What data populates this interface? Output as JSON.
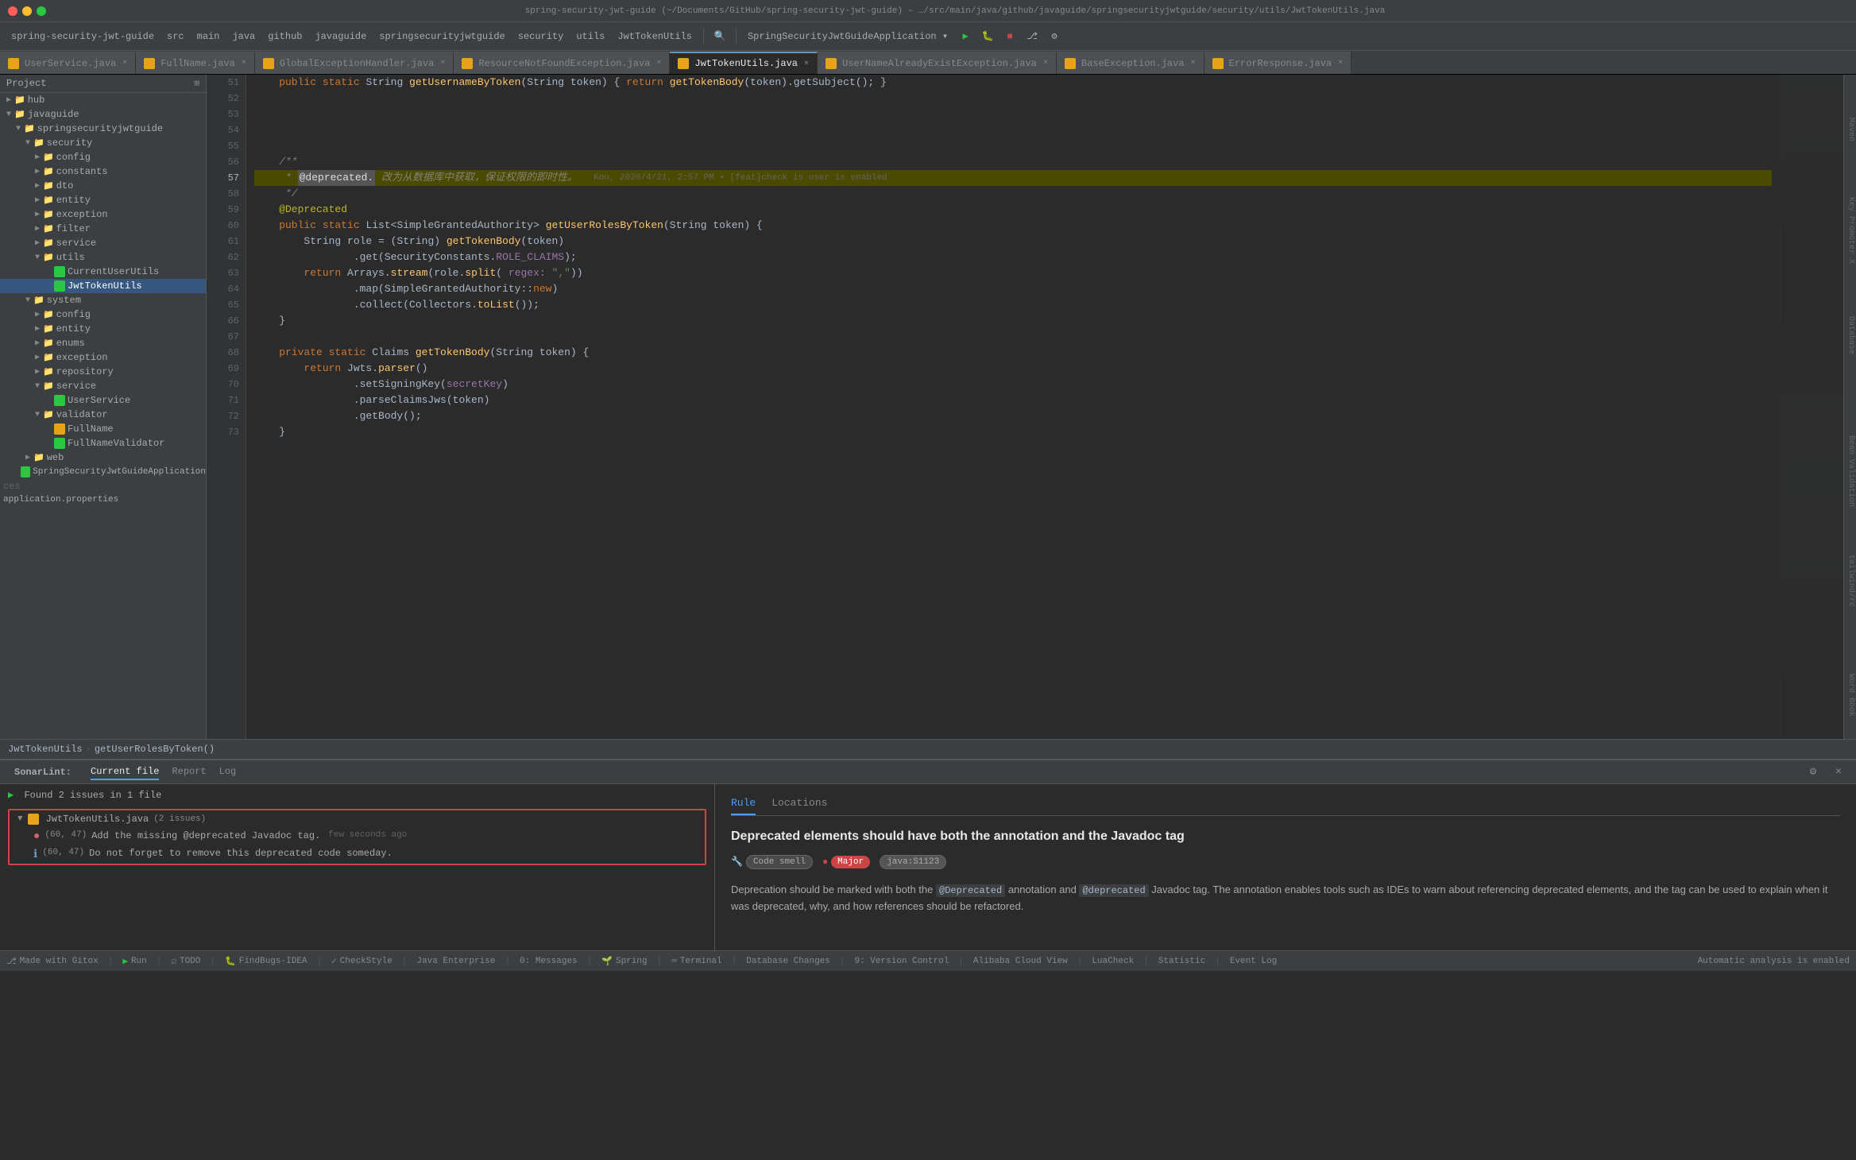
{
  "window": {
    "title": "spring-security-jwt-guide (~/Documents/GitHub/spring-security-jwt-guide) – …/src/main/java/github/javaguide/springsecurityjwtguide/security/utils/JwtTokenUtils.java",
    "traffic_lights": [
      "red",
      "yellow",
      "green"
    ]
  },
  "toolbar": {
    "project": "spring-security-jwt-guide",
    "src": "src",
    "main": "main",
    "java": "java",
    "github": "github",
    "javaguide": "javaguide",
    "springsecurityjwtguide": "springsecurityjwtguide",
    "security": "security",
    "utils": "utils",
    "file": "JwtTokenUtils",
    "run_config": "SpringSecurityJwtGuideApplication",
    "run_label": "SpringSecurityJwtGuideApplication"
  },
  "file_tabs": [
    {
      "label": "UserService.java",
      "icon": "java",
      "active": false
    },
    {
      "label": "FullName.java",
      "icon": "java",
      "active": false
    },
    {
      "label": "GlobalExceptionHandler.java",
      "icon": "java",
      "active": false
    },
    {
      "label": "ResourceNotFoundException.java",
      "icon": "java",
      "active": false
    },
    {
      "label": "JwtTokenUtils.java",
      "icon": "java",
      "active": true
    },
    {
      "label": "UserNameAlreadyExistException.java",
      "icon": "java",
      "active": false
    },
    {
      "label": "BaseException.java",
      "icon": "java",
      "active": false
    },
    {
      "label": "ErrorResponse.java",
      "icon": "java",
      "active": false
    }
  ],
  "project_tree": {
    "header": "Project",
    "items": [
      {
        "level": 0,
        "type": "folder",
        "name": "hub",
        "open": false
      },
      {
        "level": 0,
        "type": "folder",
        "name": "javaguide",
        "open": true
      },
      {
        "level": 1,
        "type": "folder",
        "name": "springsecurityjwtguide",
        "open": true
      },
      {
        "level": 2,
        "type": "folder",
        "name": "security",
        "open": true
      },
      {
        "level": 3,
        "type": "folder",
        "name": "config",
        "open": false
      },
      {
        "level": 3,
        "type": "folder",
        "name": "constants",
        "open": false
      },
      {
        "level": 3,
        "type": "folder",
        "name": "dto",
        "open": false
      },
      {
        "level": 3,
        "type": "folder",
        "name": "entity",
        "open": false
      },
      {
        "level": 3,
        "type": "folder",
        "name": "exception",
        "open": false
      },
      {
        "level": 3,
        "type": "folder",
        "name": "filter",
        "open": false
      },
      {
        "level": 3,
        "type": "folder",
        "name": "service",
        "open": false
      },
      {
        "level": 3,
        "type": "folder",
        "name": "utils",
        "open": true
      },
      {
        "level": 4,
        "type": "file",
        "name": "CurrentUserUtils",
        "ext": "java",
        "selected": false
      },
      {
        "level": 4,
        "type": "file",
        "name": "JwtTokenUtils",
        "ext": "java",
        "selected": true
      },
      {
        "level": 2,
        "type": "folder",
        "name": "system",
        "open": true
      },
      {
        "level": 3,
        "type": "folder",
        "name": "config",
        "open": false
      },
      {
        "level": 3,
        "type": "folder",
        "name": "entity",
        "open": false
      },
      {
        "level": 3,
        "type": "folder",
        "name": "enums",
        "open": false
      },
      {
        "level": 3,
        "type": "folder",
        "name": "exception",
        "open": false
      },
      {
        "level": 3,
        "type": "folder",
        "name": "repository",
        "open": false
      },
      {
        "level": 3,
        "type": "folder",
        "name": "service",
        "open": true
      },
      {
        "level": 4,
        "type": "file",
        "name": "UserService",
        "ext": "java",
        "selected": false
      },
      {
        "level": 3,
        "type": "folder",
        "name": "validator",
        "open": true
      },
      {
        "level": 4,
        "type": "file",
        "name": "FullName",
        "ext": "java",
        "selected": false
      },
      {
        "level": 4,
        "type": "file",
        "name": "FullNameValidator",
        "ext": "java",
        "selected": false
      },
      {
        "level": 2,
        "type": "folder",
        "name": "web",
        "open": false
      },
      {
        "level": 1,
        "type": "file",
        "name": "SpringSecurityJwtGuideApplication",
        "ext": "java",
        "selected": false
      },
      {
        "level": 0,
        "type": "text",
        "name": "ces"
      },
      {
        "level": 0,
        "type": "text",
        "name": "application.properties"
      }
    ]
  },
  "code": {
    "lines": [
      {
        "num": 51,
        "content": "    public static String getUsernameByToken(String token) { return getTokenBody(token).getSubject(); }"
      },
      {
        "num": 52,
        "content": ""
      },
      {
        "num": 53,
        "content": ""
      },
      {
        "num": 54,
        "content": ""
      },
      {
        "num": 55,
        "content": ""
      },
      {
        "num": 56,
        "content": "    /**"
      },
      {
        "num": 57,
        "content": "     * @deprecated. 改为从数据库中获取，保证权限的即时性。    Kou, 2020/4/21, 2:57 PM • [feat]check is user is enabled"
      },
      {
        "num": 58,
        "content": "     */"
      },
      {
        "num": 59,
        "content": "    @Deprecated"
      },
      {
        "num": 60,
        "content": "    public static List<SimpleGrantedAuthority> getUserRolesByToken(String token) {"
      },
      {
        "num": 61,
        "content": "        String role = (String) getTokenBody(token)"
      },
      {
        "num": 62,
        "content": "                .get(SecurityConstants.ROLE_CLAIMS);"
      },
      {
        "num": 63,
        "content": "        return Arrays.stream(role.split( regex: \",\"))"
      },
      {
        "num": 64,
        "content": "                .map(SimpleGrantedAuthority::new)"
      },
      {
        "num": 65,
        "content": "                .collect(Collectors.toList());"
      },
      {
        "num": 66,
        "content": "    }"
      },
      {
        "num": 67,
        "content": ""
      },
      {
        "num": 68,
        "content": "    private static Claims getTokenBody(String token) {"
      },
      {
        "num": 69,
        "content": "        return Jwts.parser()"
      },
      {
        "num": 70,
        "content": "                .setSigningKey(secretKey)"
      },
      {
        "num": 71,
        "content": "                .parseClaimsJws(token)"
      },
      {
        "num": 72,
        "content": "                .getBody();"
      },
      {
        "num": 73,
        "content": "    }"
      }
    ]
  },
  "breadcrumb": {
    "file": "JwtTokenUtils",
    "method": "getUserRolesByToken()"
  },
  "sonarlint": {
    "header": "SonarLint:",
    "tabs": [
      {
        "label": "Current file",
        "active": true
      },
      {
        "label": "Report",
        "active": false
      },
      {
        "label": "Log",
        "active": false
      }
    ],
    "summary": "Found 2 issues in 1 file",
    "file": "JwtTokenUtils.java",
    "file_issues": "2 issues",
    "issues": [
      {
        "location": "(60, 47)",
        "icon": "error",
        "text": "Add the missing @deprecated Javadoc tag.",
        "timestamp": "few seconds ago",
        "selected": false
      },
      {
        "location": "(60, 47)",
        "icon": "info",
        "text": "Do not forget to remove this deprecated code someday.",
        "timestamp": "",
        "selected": false
      }
    ],
    "rule": {
      "tabs": [
        {
          "label": "Rule",
          "active": true
        },
        {
          "label": "Locations",
          "active": false
        }
      ],
      "title": "Deprecated elements should have both the annotation and the Javadoc tag",
      "badges": [
        {
          "label": "Code smell",
          "type": "smell"
        },
        {
          "label": "Major",
          "type": "major"
        },
        {
          "label": "java:S1123",
          "type": "java"
        }
      ],
      "description": "Deprecation should be marked with both the @Deprecated annotation and @deprecated Javadoc tag. The annotation enables tools such as IDEs to warn about referencing deprecated elements, and the tag can be used to explain when it was deprecated, why, and how references should be refactored."
    }
  },
  "status_bar": {
    "git": "Made with Gitox",
    "run": "Run",
    "todo": "TODO",
    "findbugs": "FindBugs-IDEA",
    "checkstyle": "CheckStyle",
    "enterprise": "Java Enterprise",
    "messages": "0: Messages",
    "spring": "Spring",
    "terminal": "Terminal",
    "db_changes": "Database Changes",
    "git_label": "9: Version Control",
    "alibaba": "Alibaba Cloud View",
    "lua": "LuaCheck",
    "statistic": "Statistic",
    "event_log": "Event Log",
    "analysis": "Automatic analysis is enabled"
  },
  "colors": {
    "accent": "#4a9eff",
    "error": "#cc4444",
    "warn": "#e8a317",
    "info": "#6897bb",
    "bg_main": "#2b2b2b",
    "bg_panel": "#3c3f41",
    "selected": "#214283"
  }
}
